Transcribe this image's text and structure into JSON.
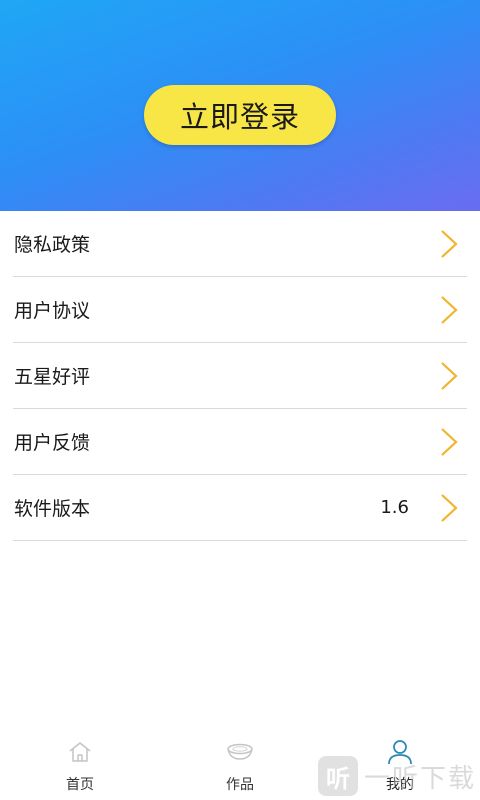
{
  "header": {
    "login_label": "立即登录",
    "accent_color": "#f8e646",
    "gradient_start": "#1fa7f5",
    "gradient_end": "#6a6cf0"
  },
  "menu": {
    "items": [
      {
        "label": "隐私政策",
        "value": ""
      },
      {
        "label": "用户协议",
        "value": ""
      },
      {
        "label": "五星好评",
        "value": ""
      },
      {
        "label": "用户反馈",
        "value": ""
      },
      {
        "label": "软件版本",
        "value": "1.6"
      }
    ],
    "chevron_icon": "chevron-right-icon",
    "chevron_color": "#f0b52a"
  },
  "tabbar": {
    "tabs": [
      {
        "label": "首页",
        "icon": "home-icon"
      },
      {
        "label": "作品",
        "icon": "bowl-icon"
      },
      {
        "label": "我的",
        "icon": "user-icon",
        "active": true
      }
    ],
    "active_color": "#2a86b8"
  },
  "watermark": {
    "badge": "听",
    "text": "一听下载"
  }
}
